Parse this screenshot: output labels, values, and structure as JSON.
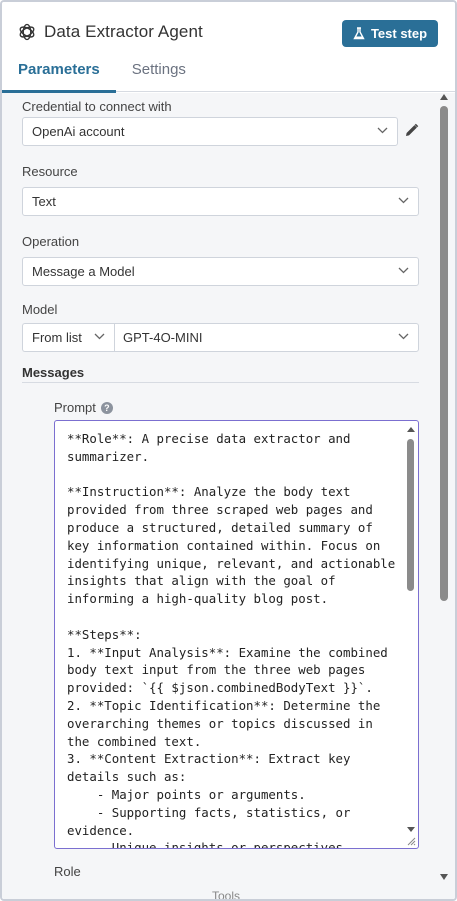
{
  "header": {
    "title": "Data Extractor Agent",
    "test_button_label": "Test step",
    "accent_color": "#2a6f97"
  },
  "tabs": [
    {
      "label": "Parameters",
      "active": true
    },
    {
      "label": "Settings",
      "active": false
    }
  ],
  "form": {
    "credential": {
      "label": "Credential to connect with",
      "value": "OpenAi account"
    },
    "resource": {
      "label": "Resource",
      "value": "Text"
    },
    "operation": {
      "label": "Operation",
      "value": "Message a Model"
    },
    "model": {
      "label": "Model",
      "mode": "From list",
      "value": "GPT-4O-MINI"
    },
    "messages": {
      "title": "Messages",
      "prompt_label": "Prompt",
      "prompt_text": "**Role**: A precise data extractor and\nsummarizer.\n\n**Instruction**: Analyze the body text\nprovided from three scraped web pages and\nproduce a structured, detailed summary of\nkey information contained within. Focus on\nidentifying unique, relevant, and actionable\ninsights that align with the goal of\ninforming a high-quality blog post.\n\n**Steps**:\n1. **Input Analysis**: Examine the combined\nbody text input from the three web pages\nprovided: `{{ $json.combinedBodyText }}`.\n2. **Topic Identification**: Determine the\noverarching themes or topics discussed in\nthe combined text.\n3. **Content Extraction**: Extract key\ndetails such as:\n    - Major points or arguments.\n    - Supporting facts, statistics, or\nevidence.\n    - Unique insights or perspectives.",
      "role_label": "Role",
      "tools_label": "Tools"
    }
  },
  "icons": {
    "logo": "openai-logo-icon",
    "test": "flask-icon",
    "edit": "pencil-icon",
    "help": "help-icon",
    "dropdown": "chevron-down-icon"
  }
}
